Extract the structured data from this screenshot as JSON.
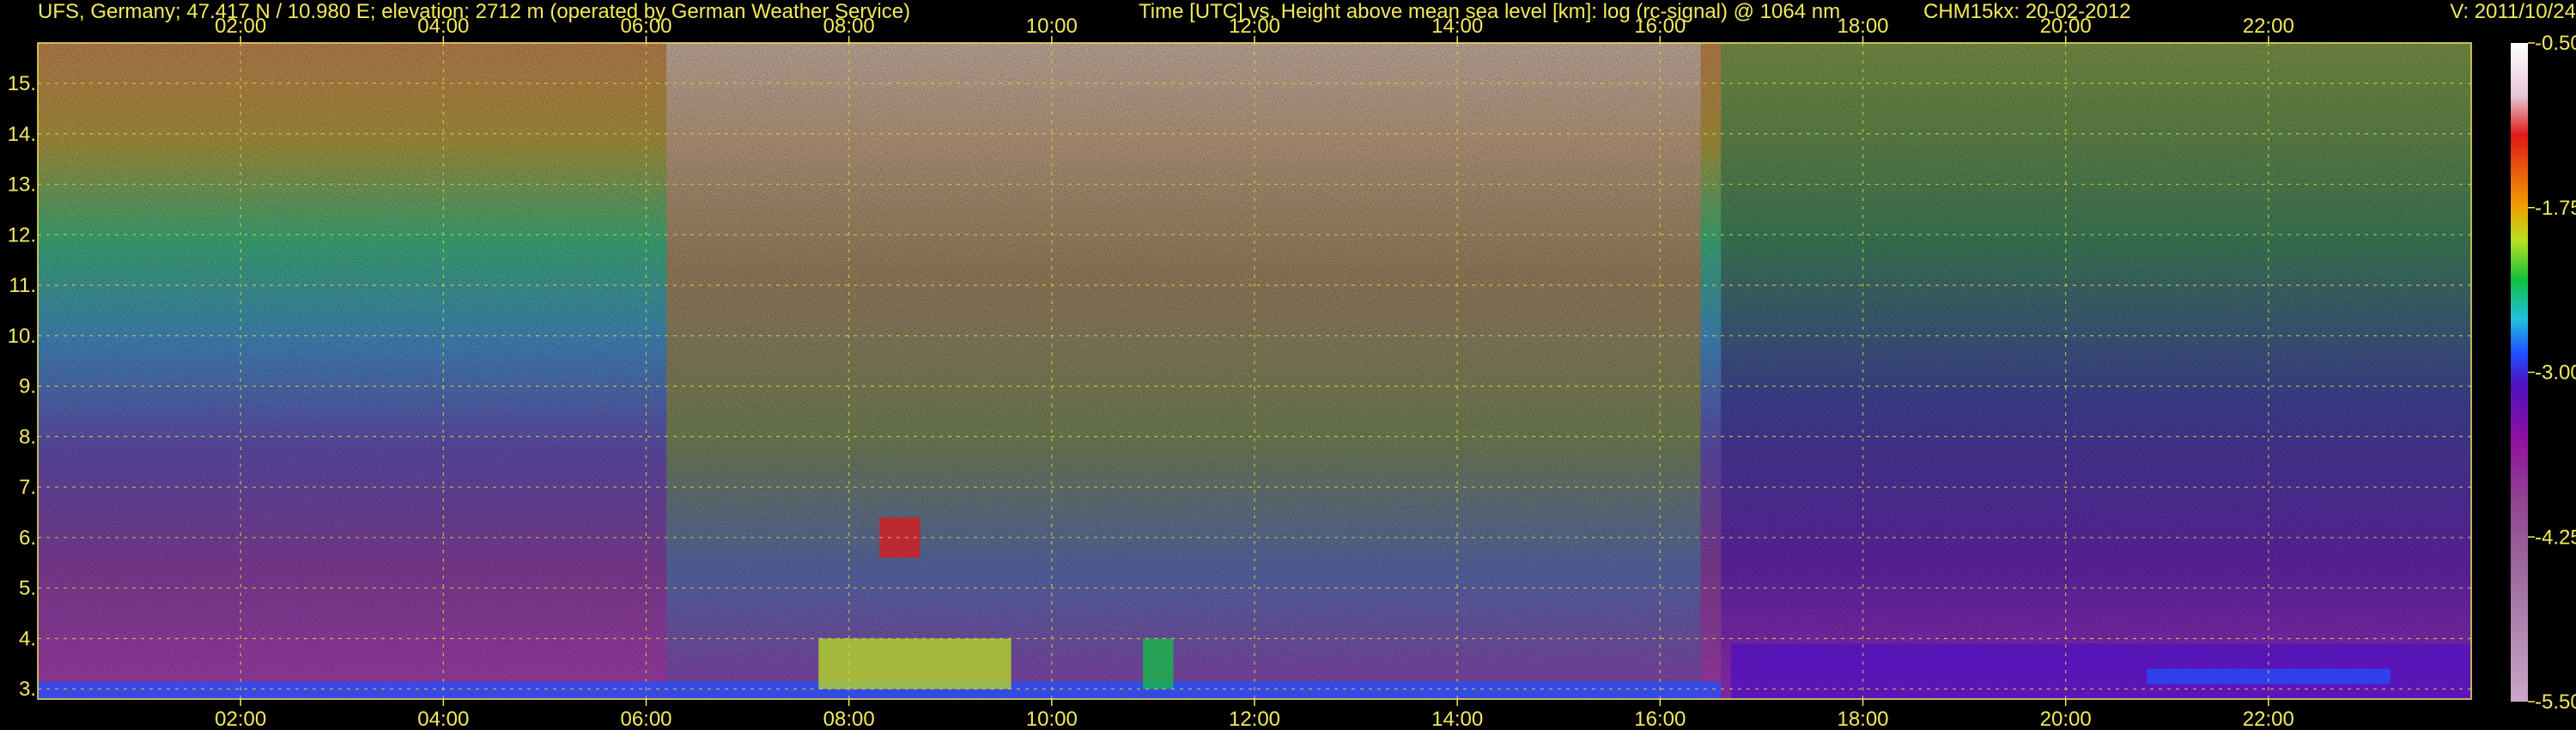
{
  "header": {
    "station": "UFS, Germany; 47.417 N / 10.980 E; elevation: 2712 m  (operated by German Weather Service)",
    "title": "Time [UTC] vs. Height above mean sea level [km]: log (rc-signal) @ 1064 nm",
    "instrument": "CHM15kx: 20-02-2012",
    "version": "V: 2011/10/24"
  },
  "chart_data": {
    "type": "heatmap",
    "title": "Time [UTC] vs. Height above mean sea level [km]: log (rc-signal) @ 1064 nm",
    "xlabel": "Time [UTC]",
    "ylabel": "Height above mean sea level [km]",
    "x_unit": "hour UTC",
    "xlim": [
      0,
      24
    ],
    "ylim": [
      2.8,
      15.8
    ],
    "x_ticks": [
      2,
      4,
      6,
      8,
      10,
      12,
      14,
      16,
      18,
      20,
      22
    ],
    "x_tick_labels": [
      "02:00",
      "04:00",
      "06:00",
      "08:00",
      "10:00",
      "12:00",
      "14:00",
      "16:00",
      "18:00",
      "20:00",
      "22:00"
    ],
    "y_ticks": [
      3,
      4,
      5,
      6,
      7,
      8,
      9,
      10,
      11,
      12,
      13,
      14,
      15
    ],
    "y_tick_labels": [
      "3.",
      "4.",
      "5.",
      "6.",
      "7.",
      "8.",
      "9.",
      "10.",
      "11.",
      "12.",
      "13.",
      "14.",
      "15."
    ],
    "grid": true,
    "colorbar": {
      "label": "log (rc-signal)",
      "range": [
        -5.5,
        -0.5
      ],
      "ticks": [
        -0.5,
        -1.75,
        -3.0,
        -4.25,
        -5.5
      ],
      "tick_labels": [
        "-0.50",
        "-1.75",
        "-3.00",
        "-4.25",
        "-5.50"
      ],
      "stops": [
        {
          "value": -0.5,
          "color": "#ffffff"
        },
        {
          "value": -0.9,
          "color": "#e6c8d8"
        },
        {
          "value": -1.2,
          "color": "#e01818"
        },
        {
          "value": -1.75,
          "color": "#f0a000"
        },
        {
          "value": -2.0,
          "color": "#b8e020"
        },
        {
          "value": -2.3,
          "color": "#10c040"
        },
        {
          "value": -2.6,
          "color": "#20c0e0"
        },
        {
          "value": -2.85,
          "color": "#2050ff"
        },
        {
          "value": -3.1,
          "color": "#5010c0"
        },
        {
          "value": -3.5,
          "color": "#9010a0"
        },
        {
          "value": -4.0,
          "color": "#904890"
        },
        {
          "value": -4.6,
          "color": "#a070a0"
        },
        {
          "value": -5.5,
          "color": "#c8a8c8"
        }
      ]
    },
    "features": [
      {
        "name": "ground-noise-layer",
        "x": [
          0.0,
          16.6
        ],
        "y": [
          2.8,
          3.15
        ],
        "value": -3.0
      },
      {
        "name": "cloud-column-cluster",
        "x": [
          7.7,
          9.6
        ],
        "y": [
          3.0,
          4.0
        ],
        "value": -2.2
      },
      {
        "name": "elevated-cloud",
        "x": [
          8.3,
          8.7
        ],
        "y": [
          5.6,
          6.4
        ],
        "value": -1.6
      },
      {
        "name": "cloud-patch",
        "x": [
          10.9,
          11.2
        ],
        "y": [
          3.0,
          4.0
        ],
        "value": -2.4
      },
      {
        "name": "low-layer-evening",
        "x": [
          16.7,
          24.0
        ],
        "y": [
          2.8,
          3.9
        ],
        "value": -3.4
      },
      {
        "name": "thin-layer-22h",
        "x": [
          20.8,
          23.2
        ],
        "y": [
          3.1,
          3.4
        ],
        "value": -2.9
      }
    ]
  }
}
